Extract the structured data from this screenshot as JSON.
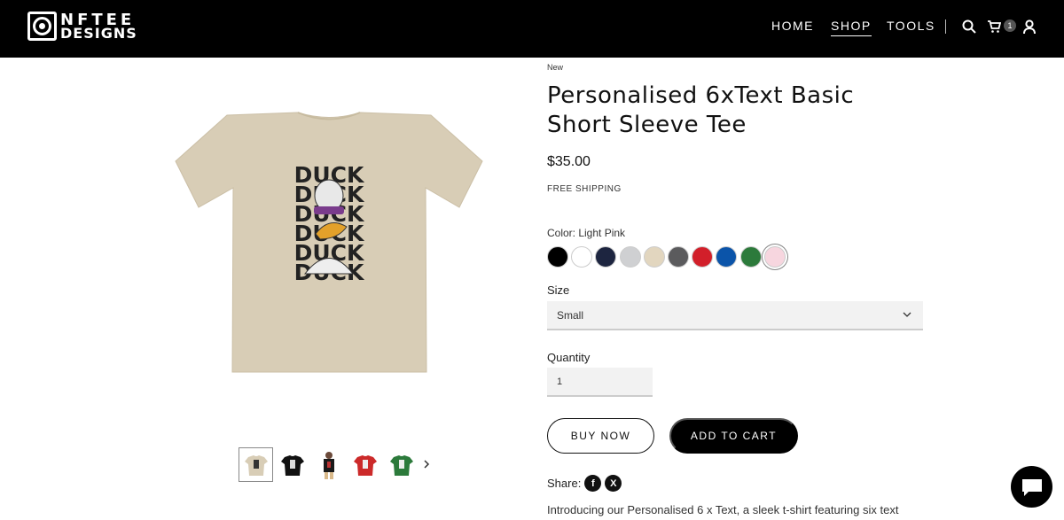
{
  "brand": {
    "logo_line1": "NFTEE",
    "logo_line2": "DESIGNS"
  },
  "nav": {
    "items": [
      {
        "label": "HOME"
      },
      {
        "label": "SHOP"
      },
      {
        "label": "TOOLS"
      }
    ],
    "active": "SHOP"
  },
  "header_icons": {
    "search": "search-icon",
    "cart": "cart-icon",
    "account": "user-icon",
    "cart_count": "1"
  },
  "product": {
    "badge": "New",
    "title": "Personalised 6xText Basic Short Sleeve Tee",
    "price": "$35.00",
    "shipping": "FREE SHIPPING",
    "color_label": "Color: Light Pink",
    "print_text": "DUCK",
    "colors": [
      {
        "name": "Black",
        "hex": "#000000"
      },
      {
        "name": "White",
        "hex": "#ffffff"
      },
      {
        "name": "Navy",
        "hex": "#1d2540"
      },
      {
        "name": "Sport Grey",
        "hex": "#cfd0d2"
      },
      {
        "name": "Sand",
        "hex": "#e2d6bf"
      },
      {
        "name": "Charcoal",
        "hex": "#5b5b5d"
      },
      {
        "name": "Red",
        "hex": "#d21f2a"
      },
      {
        "name": "Royal",
        "hex": "#0b54a9"
      },
      {
        "name": "Irish Green",
        "hex": "#2c7a3b"
      },
      {
        "name": "Light Pink",
        "hex": "#f7d6df"
      }
    ],
    "selected_color_index": 9,
    "size_label": "Size",
    "size_value": "Small",
    "quantity_label": "Quantity",
    "quantity_value": "1",
    "buy_now": "BUY NOW",
    "add_to_cart": "ADD TO CART",
    "share_label": "Share:",
    "description": "Introducing our Personalised 6 x Text, a sleek t-shirt featuring six text",
    "thumbnails": [
      {
        "color": "#d8cdb6",
        "print": "#333"
      },
      {
        "color": "#111111",
        "print": "#ddd"
      },
      {
        "color": "#1a1a1a",
        "print": "#b33"
      },
      {
        "color": "#cc2a2a",
        "print": "#eee"
      },
      {
        "color": "#2c7a3b",
        "print": "#eee"
      }
    ]
  }
}
